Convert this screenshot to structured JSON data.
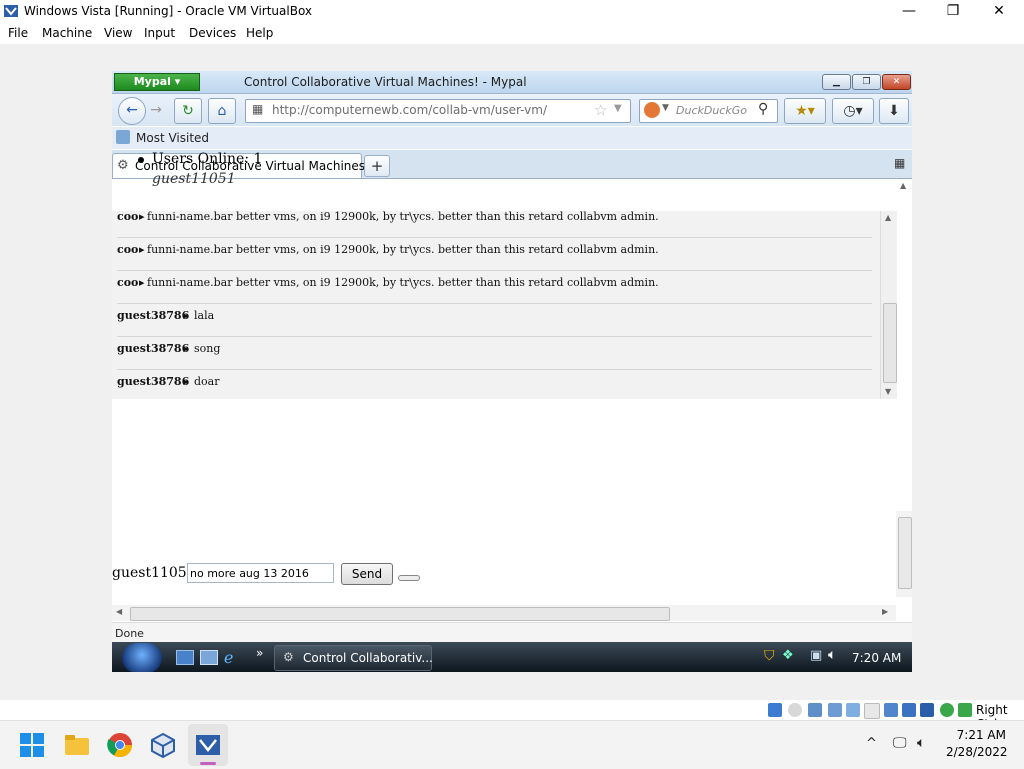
{
  "host_window": {
    "title": "Windows Vista [Running] - Oracle VM VirtualBox",
    "menu": [
      "File",
      "Machine",
      "View",
      "Input",
      "Devices",
      "Help"
    ],
    "controls": {
      "minimize": "—",
      "maximize": "❐",
      "close": "✕"
    },
    "host_key_label": "Right Ctrl"
  },
  "browser": {
    "menu_button": "Mypal",
    "window_title": "Control Collaborative Virtual Machines! - Mypal",
    "url": "http://computernewb.com/collab-vm/user-vm/",
    "search_placeholder": "DuckDuckGo",
    "bookmark_item": "Most Visited",
    "tab_title": "Control Collaborative Virtual Machines!",
    "new_tab_label": "+",
    "status": "Done"
  },
  "page": {
    "users_online": "Users Online: 1",
    "current_user": "guest11051",
    "chat_messages": [
      {
        "user": "coo",
        "text": "funni-name.bar better vms, on i9 12900k, by tr\\ycs. better than this retard collabvm admin."
      },
      {
        "user": "coo",
        "text": "funni-name.bar better vms, on i9 12900k, by tr\\ycs. better than this retard collabvm admin."
      },
      {
        "user": "coo",
        "text": "funni-name.bar better vms, on i9 12900k, by tr\\ycs. better than this retard collabvm admin."
      },
      {
        "user": "guest38786",
        "text": "lala"
      },
      {
        "user": "guest38786",
        "text": "song"
      },
      {
        "user": "guest38786",
        "text": "doar"
      }
    ],
    "username_label": "guest11051",
    "chat_input_value": "no more aug 13 2016",
    "send_button": "Send"
  },
  "guest_taskbar": {
    "task_label": "Control Collaborativ...",
    "clock": "7:20 AM",
    "quicklaunch_more": "»"
  },
  "host_taskbar": {
    "time": "7:21 AM",
    "date": "2/28/2022",
    "tray_chevron": "^"
  },
  "colors": {
    "mypal_green": "#2a9a2a",
    "vista_taskbar": "#1b2630",
    "close_red": "#c24526"
  }
}
